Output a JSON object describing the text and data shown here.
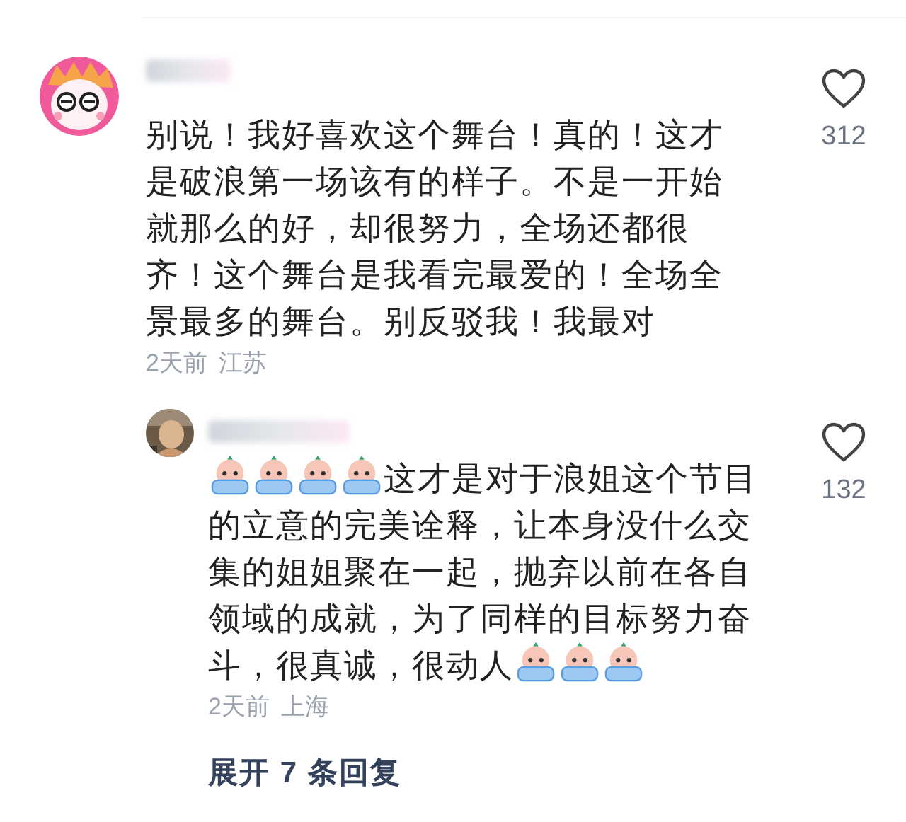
{
  "comment": {
    "avatar": {
      "kind": "cartoon"
    },
    "segments": [
      {
        "kind": "text",
        "text": "别说！我好喜欢这个舞台！真的！这才是破浪第一场该有的样子。不是一开始就那么的好，却很努力，全场还都很齐！这个舞台是我看完最爱的！全场全景最多的舞台。别反驳我！我最对"
      }
    ],
    "time": "2天前",
    "location": "江苏",
    "likes": "312",
    "replies": [
      {
        "segments": [
          {
            "kind": "emoji"
          },
          {
            "kind": "emoji"
          },
          {
            "kind": "emoji"
          },
          {
            "kind": "emoji"
          },
          {
            "kind": "text",
            "text": "这才是对于浪姐这个节目"
          },
          {
            "kind": "text",
            "text": "的立意的完美诠释，让本身没什么交集的姐姐聚在一起，抛弃以前在各自领域的成就，为了同样的目标努力奋"
          },
          {
            "kind": "text",
            "text": "斗，很真诚，很动人"
          },
          {
            "kind": "emoji"
          },
          {
            "kind": "emoji"
          },
          {
            "kind": "emoji"
          }
        ],
        "time": "2天前",
        "location": "上海",
        "likes": "132"
      }
    ],
    "expand_replies": "展开 7 条回复"
  }
}
